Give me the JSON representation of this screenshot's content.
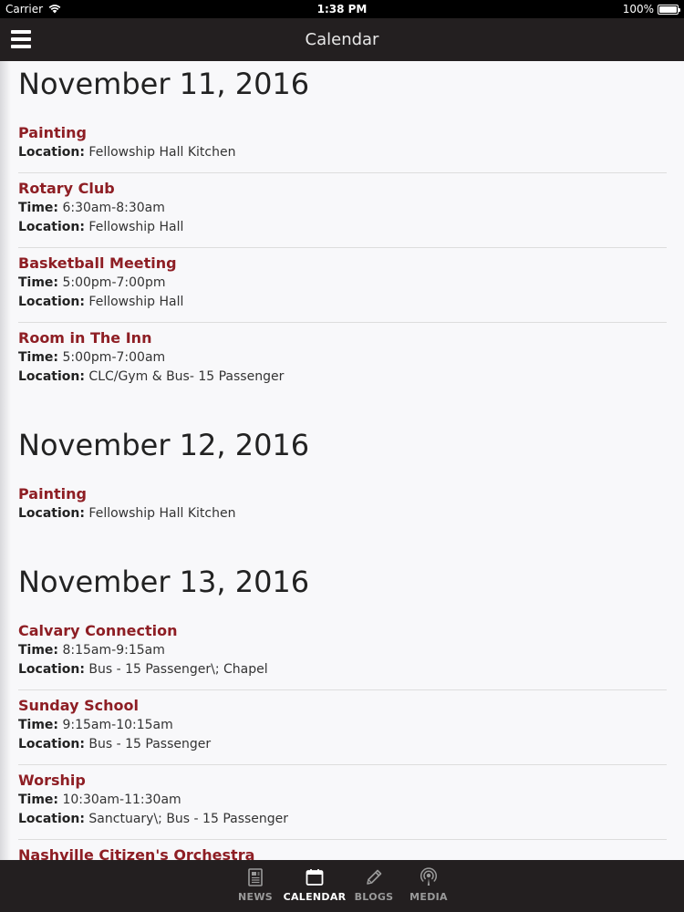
{
  "status": {
    "carrier": "Carrier",
    "time": "1:38 PM",
    "battery": "100%"
  },
  "header": {
    "title": "Calendar"
  },
  "days": [
    {
      "heading": "November 11, 2016",
      "events": [
        {
          "title": "Painting",
          "location_label": "Location:",
          "location": "Fellowship Hall Kitchen"
        },
        {
          "title": "Rotary Club",
          "time_label": "Time:",
          "time": "6:30am-8:30am",
          "location_label": "Location:",
          "location": "Fellowship Hall"
        },
        {
          "title": "Basketball Meeting",
          "time_label": "Time:",
          "time": "5:00pm-7:00pm",
          "location_label": "Location:",
          "location": "Fellowship Hall"
        },
        {
          "title": "Room in The Inn",
          "time_label": "Time:",
          "time": "5:00pm-7:00am",
          "location_label": "Location:",
          "location": "CLC/Gym & Bus- 15 Passenger"
        }
      ]
    },
    {
      "heading": "November 12, 2016",
      "events": [
        {
          "title": "Painting",
          "location_label": "Location:",
          "location": "Fellowship Hall Kitchen"
        }
      ]
    },
    {
      "heading": "November 13, 2016",
      "events": [
        {
          "title": "Calvary Connection",
          "time_label": "Time:",
          "time": "8:15am-9:15am",
          "location_label": "Location:",
          "location": "Bus - 15 Passenger\\; Chapel"
        },
        {
          "title": "Sunday School",
          "time_label": "Time:",
          "time": "9:15am-10:15am",
          "location_label": "Location:",
          "location": "Bus - 15 Passenger"
        },
        {
          "title": "Worship",
          "time_label": "Time:",
          "time": "10:30am-11:30am",
          "location_label": "Location:",
          "location": "Sanctuary\\; Bus - 15 Passenger"
        },
        {
          "title": "Nashville Citizen's Orchestra"
        }
      ]
    }
  ],
  "tabs": [
    {
      "label": "NEWS",
      "icon": "news-icon",
      "active": false
    },
    {
      "label": "CALENDAR",
      "icon": "calendar-icon",
      "active": true
    },
    {
      "label": "BLOGS",
      "icon": "pencil-icon",
      "active": false
    },
    {
      "label": "MEDIA",
      "icon": "podcast-icon",
      "active": false
    }
  ],
  "colors": {
    "accent": "#8e1e24",
    "bar": "#231f20"
  }
}
